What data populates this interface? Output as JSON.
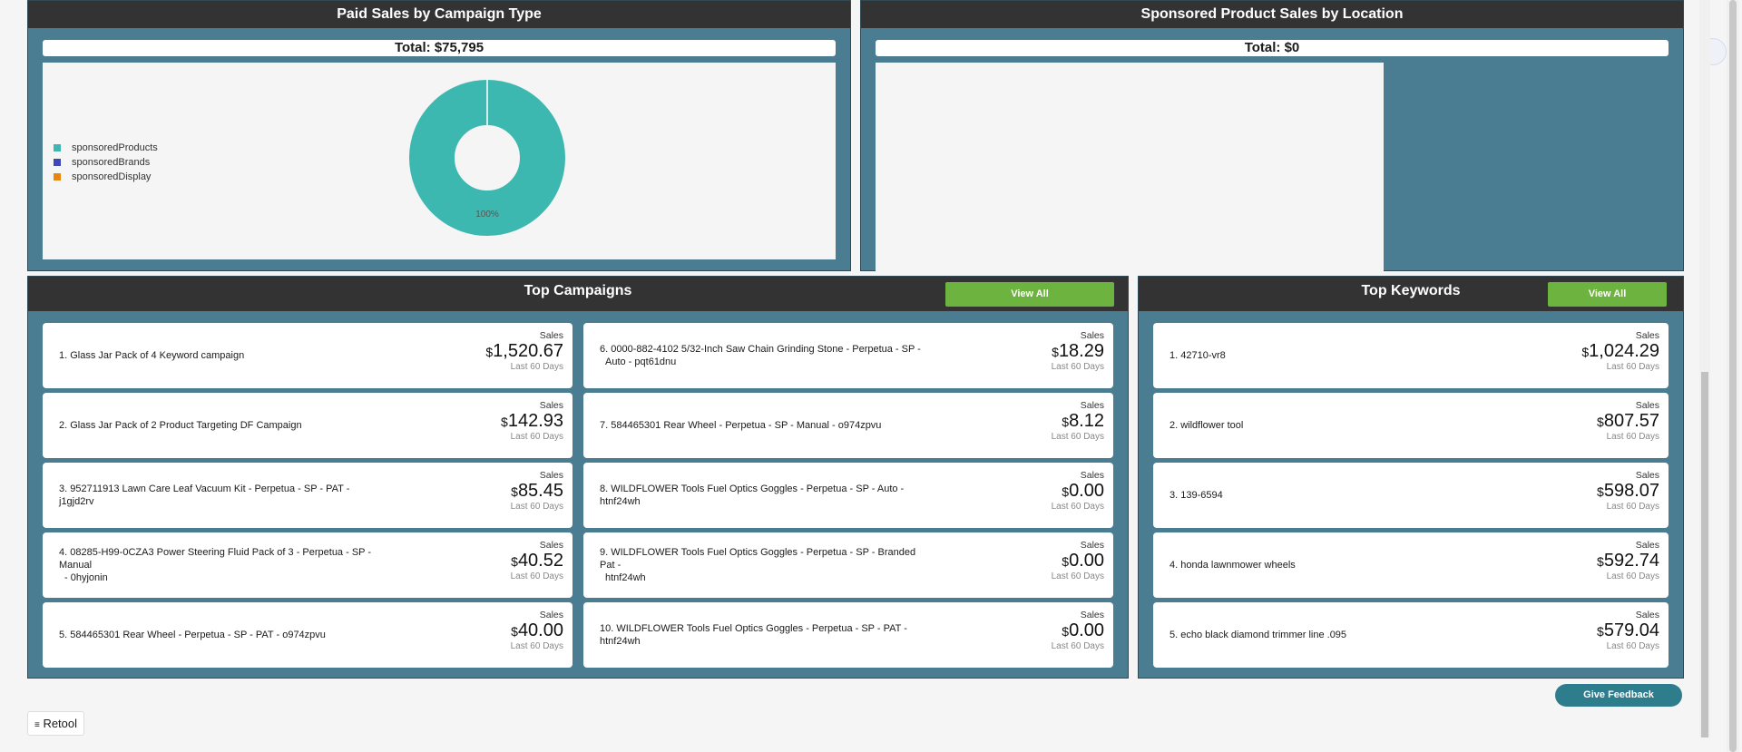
{
  "paid_sales": {
    "title": "Paid Sales by Campaign Type",
    "total": "Total: $75,795",
    "legend": [
      {
        "label": "sponsoredProducts",
        "color": "#3db8b0"
      },
      {
        "label": "sponsoredBrands",
        "color": "#3f47b8"
      },
      {
        "label": "sponsoredDisplay",
        "color": "#e8870e"
      }
    ],
    "donut_label": "100%"
  },
  "chart_data": {
    "type": "pie",
    "categories": [
      "sponsoredProducts",
      "sponsoredBrands",
      "sponsoredDisplay"
    ],
    "values": [
      100,
      0,
      0
    ],
    "colors": [
      "#3db8b0",
      "#3f47b8",
      "#e8870e"
    ]
  },
  "location": {
    "title": "Sponsored Product Sales by Location",
    "total": "Total: $0"
  },
  "campaigns": {
    "title": "Top Campaigns",
    "view_all": "View All",
    "items": [
      {
        "name": "1. Glass Jar Pack of 4 Keyword campaign",
        "name2": "",
        "sales_label": "Sales",
        "currency": "$",
        "value": "1,520.67",
        "period": "Last 60 Days"
      },
      {
        "name": "2. Glass Jar Pack of 2 Product Targeting DF Campaign",
        "name2": "",
        "sales_label": "Sales",
        "currency": "$",
        "value": "142.93",
        "period": "Last 60 Days"
      },
      {
        "name": "3. 952711913 Lawn Care Leaf Vacuum Kit - Perpetua - SP - PAT - j1gjd2rv",
        "name2": "",
        "sales_label": "Sales",
        "currency": "$",
        "value": "85.45",
        "period": "Last 60 Days"
      },
      {
        "name": "4. 08285-H99-0CZA3 Power Steering Fluid Pack of 3 - Perpetua - SP - Manual",
        "name2": "- 0hyjonin",
        "sales_label": "Sales",
        "currency": "$",
        "value": "40.52",
        "period": "Last 60 Days"
      },
      {
        "name": "5. 584465301 Rear Wheel - Perpetua - SP - PAT - o974zpvu",
        "name2": "",
        "sales_label": "Sales",
        "currency": "$",
        "value": "40.00",
        "period": "Last 60 Days"
      },
      {
        "name": "6. 0000-882-4102 5/32-Inch Saw Chain Grinding Stone - Perpetua - SP -",
        "name2": "Auto - pqt61dnu",
        "sales_label": "Sales",
        "currency": "$",
        "value": "18.29",
        "period": "Last 60 Days"
      },
      {
        "name": "7. 584465301 Rear Wheel - Perpetua - SP - Manual - o974zpvu",
        "name2": "",
        "sales_label": "Sales",
        "currency": "$",
        "value": "8.12",
        "period": "Last 60 Days"
      },
      {
        "name": "8. WILDFLOWER Tools Fuel Optics Goggles - Perpetua - SP - Auto - htnf24wh",
        "name2": "",
        "sales_label": "Sales",
        "currency": "$",
        "value": "0.00",
        "period": "Last 60 Days"
      },
      {
        "name": "9. WILDFLOWER Tools Fuel Optics Goggles - Perpetua - SP - Branded Pat -",
        "name2": "htnf24wh",
        "sales_label": "Sales",
        "currency": "$",
        "value": "0.00",
        "period": "Last 60 Days"
      },
      {
        "name": "10. WILDFLOWER Tools Fuel Optics Goggles - Perpetua - SP - PAT - htnf24wh",
        "name2": "",
        "sales_label": "Sales",
        "currency": "$",
        "value": "0.00",
        "period": "Last 60 Days"
      }
    ]
  },
  "keywords": {
    "title": "Top Keywords",
    "view_all": "View All",
    "items": [
      {
        "name": "1. 42710-vr8",
        "sales_label": "Sales",
        "currency": "$",
        "value": "1,024.29",
        "period": "Last 60 Days"
      },
      {
        "name": "2. wildflower tool",
        "sales_label": "Sales",
        "currency": "$",
        "value": "807.57",
        "period": "Last 60 Days"
      },
      {
        "name": "3. 139-6594",
        "sales_label": "Sales",
        "currency": "$",
        "value": "598.07",
        "period": "Last 60 Days"
      },
      {
        "name": "4. honda lawnmower wheels",
        "sales_label": "Sales",
        "currency": "$",
        "value": "592.74",
        "period": "Last 60 Days"
      },
      {
        "name": "5. echo black diamond trimmer line .095",
        "sales_label": "Sales",
        "currency": "$",
        "value": "579.04",
        "period": "Last 60 Days"
      }
    ]
  },
  "feedback_label": "Give Feedback",
  "retool_label": "Retool"
}
